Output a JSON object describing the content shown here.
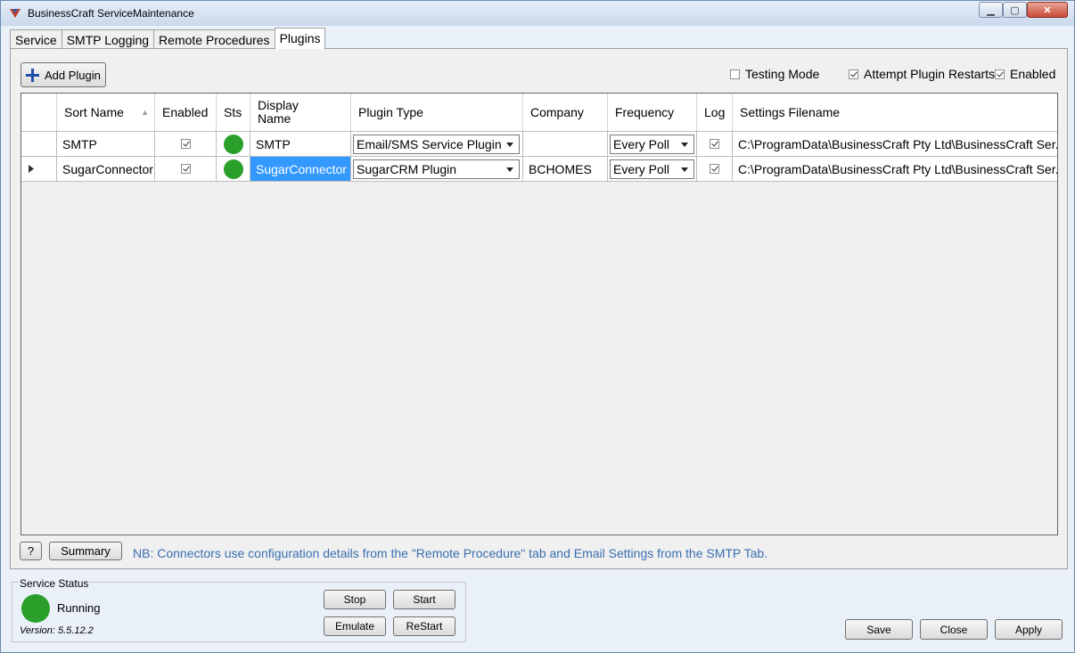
{
  "window": {
    "title": "BusinessCraft ServiceMaintenance",
    "controls": {
      "minimize": "▁",
      "maximize": "▢",
      "close": "✕"
    }
  },
  "tabs": [
    {
      "label": "Service",
      "active": false
    },
    {
      "label": "SMTP Logging",
      "active": false
    },
    {
      "label": "Remote Procedures",
      "active": false
    },
    {
      "label": "Plugins",
      "active": true
    }
  ],
  "toolbar": {
    "add_plugin_label": "Add Plugin",
    "testing_mode": {
      "label": "Testing Mode",
      "checked": false
    },
    "attempt_restarts": {
      "label": "Attempt Plugin Restarts",
      "checked": true
    },
    "enabled": {
      "label": "Enabled",
      "checked": true
    }
  },
  "grid": {
    "columns": [
      "Sort Name",
      "Enabled",
      "Sts",
      "Display\nName",
      "Plugin Type",
      "Company",
      "Frequency",
      "Log",
      "Settings Filename"
    ],
    "sort_indicator": "▲",
    "rows": [
      {
        "sort_name": "SMTP",
        "enabled": true,
        "status_color": "#2aa02a",
        "display_name": "SMTP",
        "plugin_type": "Email/SMS Service Plugin",
        "company": "",
        "frequency": "Every Poll",
        "log": true,
        "settings_filename": "C:\\ProgramData\\BusinessCraft Pty Ltd\\BusinessCraft Ser...",
        "current": false
      },
      {
        "sort_name": "SugarConnector",
        "enabled": true,
        "status_color": "#2aa02a",
        "display_name": "SugarConnector",
        "plugin_type": "SugarCRM Plugin",
        "company": "BCHOMES",
        "frequency": "Every Poll",
        "log": true,
        "settings_filename": "C:\\ProgramData\\BusinessCraft Pty Ltd\\BusinessCraft Ser...",
        "current": true
      }
    ]
  },
  "footer": {
    "help_label": "?",
    "summary_label": "Summary",
    "note": "NB: Connectors use configuration details from the \"Remote Procedure\" tab and Email Settings from the SMTP Tab."
  },
  "service_status": {
    "group_label": "Service Status",
    "status_text": "Running",
    "status_color": "#2aa02a",
    "version": "Version: 5.5.12.2",
    "stop_label": "Stop",
    "start_label": "Start",
    "emulate_label": "Emulate",
    "restart_label": "ReStart"
  },
  "actions": {
    "save_label": "Save",
    "close_label": "Close",
    "apply_label": "Apply"
  }
}
